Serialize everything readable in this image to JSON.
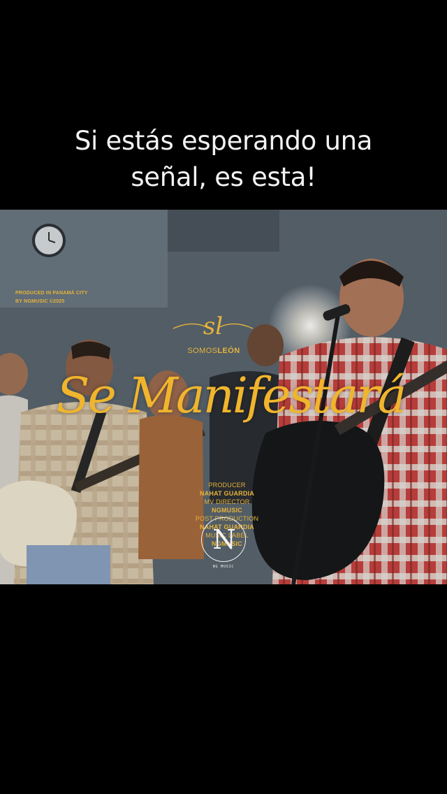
{
  "caption": {
    "line1": "Si estás esperando una",
    "line2": "señal, es esta!"
  },
  "video": {
    "produced_line1": "PRODUCED IN PANAMÁ CITY",
    "produced_line2": "BY NGMUSIC ©2025",
    "monogram": "sl",
    "brand_prefix": "SOMOS",
    "brand_suffix": "LEÓN",
    "title": "Se Manifestará",
    "credits": {
      "producer_label": "PRODUCER ",
      "producer_name": "NAHAT GUARDIA",
      "director_label": "MV DIRECTOR ",
      "director_name": "NGMUSIC",
      "post_label": " POST PRODUCTION ",
      "post_name": "NAHAT GUARDIA",
      "label_label": " MUSIC LABEL ",
      "label_name": "NGMUSIC"
    },
    "logo_letter": "N",
    "logo_label": "NG MUSIC"
  },
  "colors": {
    "accent_gold": "#f0b52d",
    "background": "#000000"
  }
}
